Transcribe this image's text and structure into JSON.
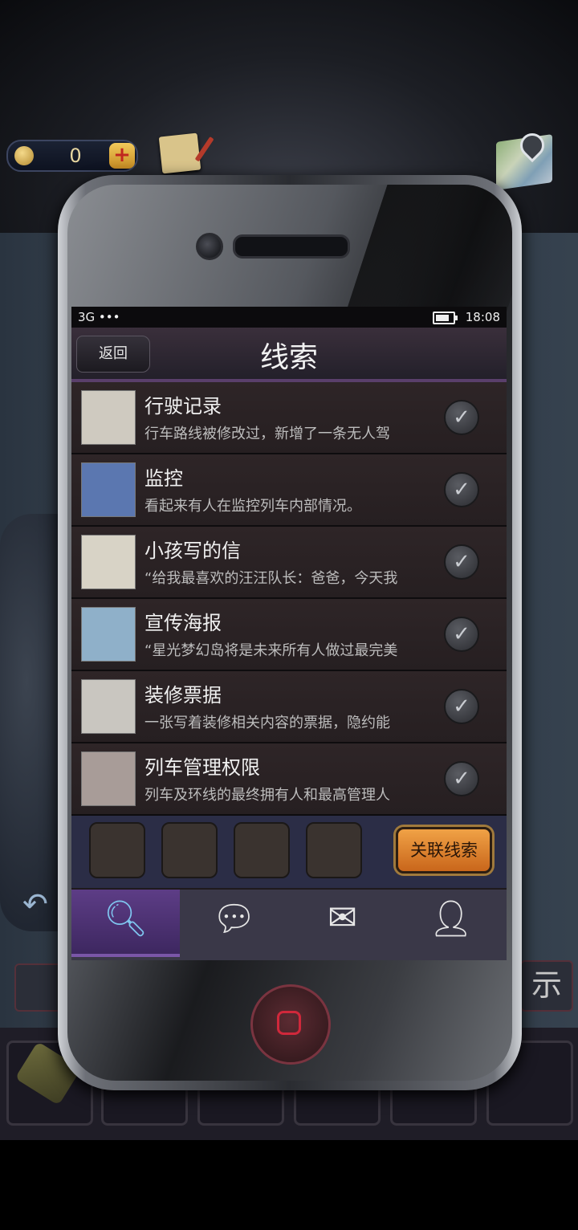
{
  "hud": {
    "coins": "0",
    "plus_label": "+"
  },
  "status_bar": {
    "network": "3G •••",
    "time": "18:08"
  },
  "header": {
    "back_label": "返回",
    "title": "线索"
  },
  "clues": [
    {
      "title": "行驶记录",
      "desc": "行车路线被修改过，新增了一条无人驾",
      "thumb_color": "#cfcac0"
    },
    {
      "title": "监控",
      "desc": "看起来有人在监控列车内部情况。",
      "thumb_color": "#5b77b0"
    },
    {
      "title": "小孩写的信",
      "desc": "“给我最喜欢的汪汪队长：爸爸，今天我",
      "thumb_color": "#d8d3c6"
    },
    {
      "title": "宣传海报",
      "desc": "“星光梦幻岛将是未来所有人做过最完美",
      "thumb_color": "#8fb0c9"
    },
    {
      "title": "装修票据",
      "desc": "一张写着装修相关内容的票据，隐约能",
      "thumb_color": "#c9c6c0"
    },
    {
      "title": "列车管理权限",
      "desc": "列车及环线的最终拥有人和最高管理人",
      "thumb_color": "#a89c98"
    }
  ],
  "link_button": "关联线索",
  "check_glyph": "✓",
  "side_label": "示",
  "tabs": [
    {
      "icon": "search-icon",
      "glyph": "🔍︎"
    },
    {
      "icon": "chat-icon",
      "glyph": "💬︎"
    },
    {
      "icon": "mail-icon",
      "glyph": "✉"
    },
    {
      "icon": "user-icon",
      "glyph": "👤︎"
    }
  ]
}
